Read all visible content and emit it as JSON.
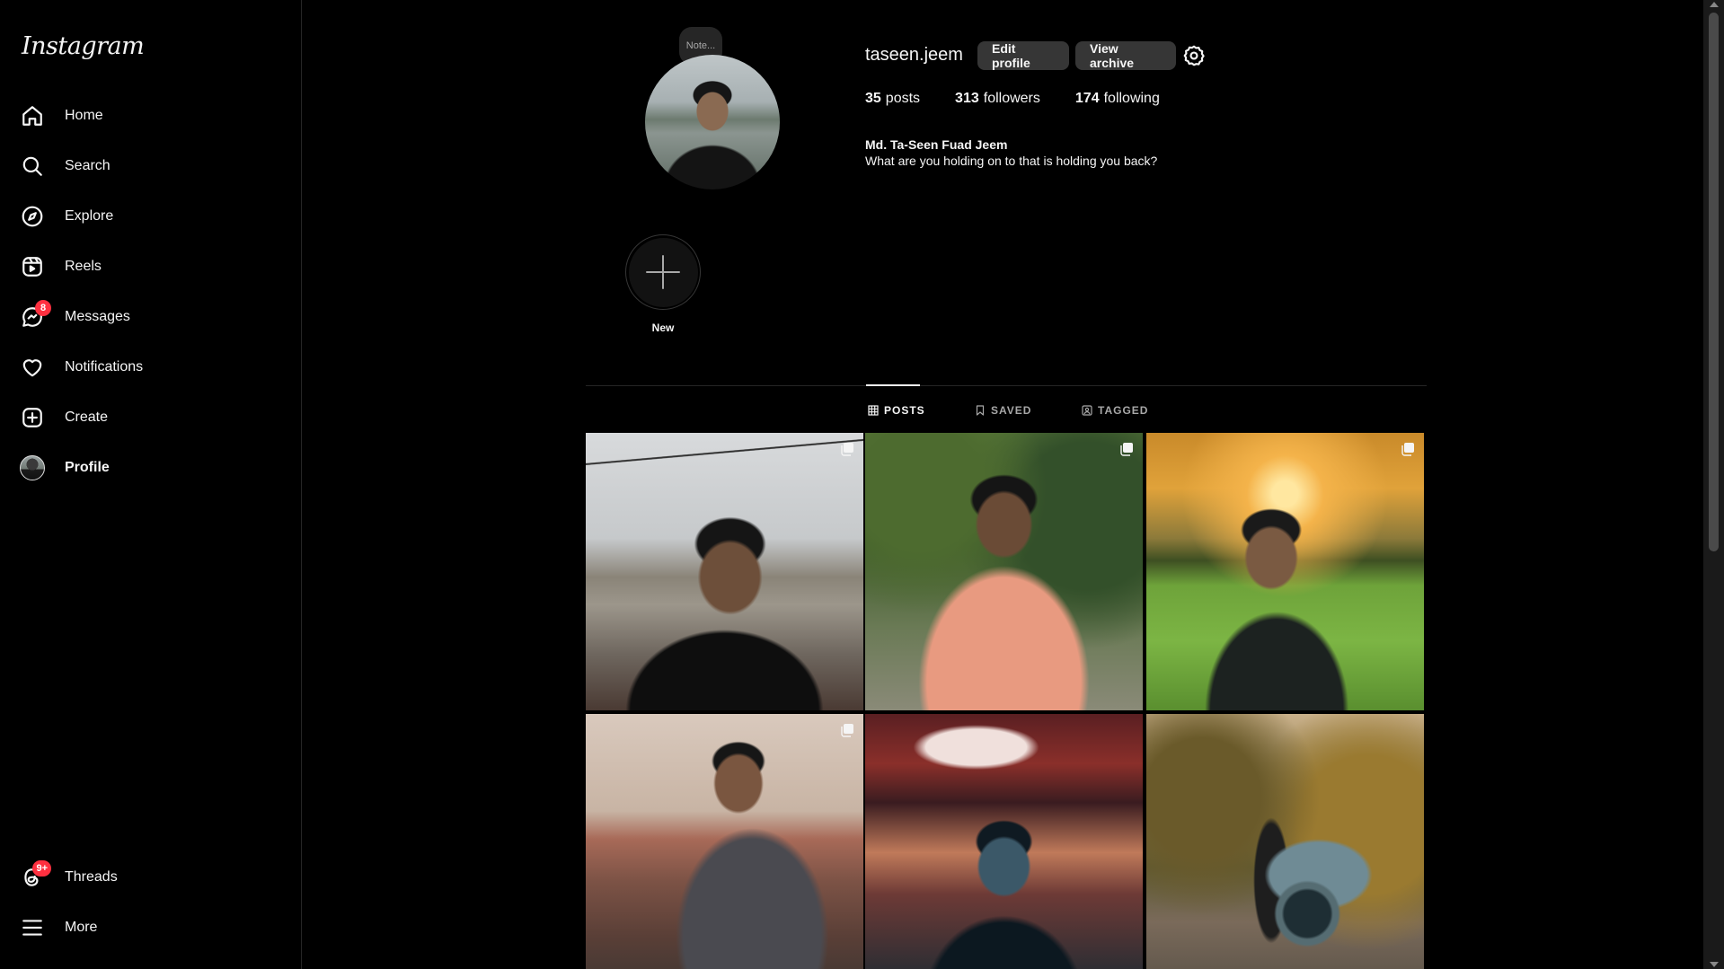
{
  "sidebar": {
    "logo": "Instagram",
    "items": [
      {
        "label": "Home",
        "icon": "home-icon"
      },
      {
        "label": "Search",
        "icon": "search-icon"
      },
      {
        "label": "Explore",
        "icon": "compass-icon"
      },
      {
        "label": "Reels",
        "icon": "reels-icon"
      },
      {
        "label": "Messages",
        "icon": "messenger-icon",
        "badge": "8"
      },
      {
        "label": "Notifications",
        "icon": "heart-icon"
      },
      {
        "label": "Create",
        "icon": "plus-square-icon"
      },
      {
        "label": "Profile",
        "icon": "avatar"
      },
      {
        "label": "Threads",
        "icon": "threads-icon",
        "badge": "9+"
      },
      {
        "label": "More",
        "icon": "menu-icon"
      }
    ]
  },
  "profile": {
    "note": "Note...",
    "username": "taseen.jeem",
    "edit_button": "Edit profile",
    "archive_button": "View archive",
    "stats": {
      "posts_count": "35",
      "posts_label": "posts",
      "followers_count": "313",
      "followers_label": "followers",
      "following_count": "174",
      "following_label": "following"
    },
    "full_name": "Md. Ta-Seen Fuad Jeem",
    "bio": "What are you holding on to that is holding you back?",
    "new_highlight_label": "New"
  },
  "tabs": [
    {
      "label": "POSTS",
      "icon": "grid-icon",
      "active": true
    },
    {
      "label": "SAVED",
      "icon": "bookmark-icon",
      "active": false
    },
    {
      "label": "TAGGED",
      "icon": "tag-icon",
      "active": false
    }
  ],
  "colors": {
    "background": "#000000",
    "badge": "#ff3040",
    "button": "#363636",
    "divider": "#262626"
  }
}
